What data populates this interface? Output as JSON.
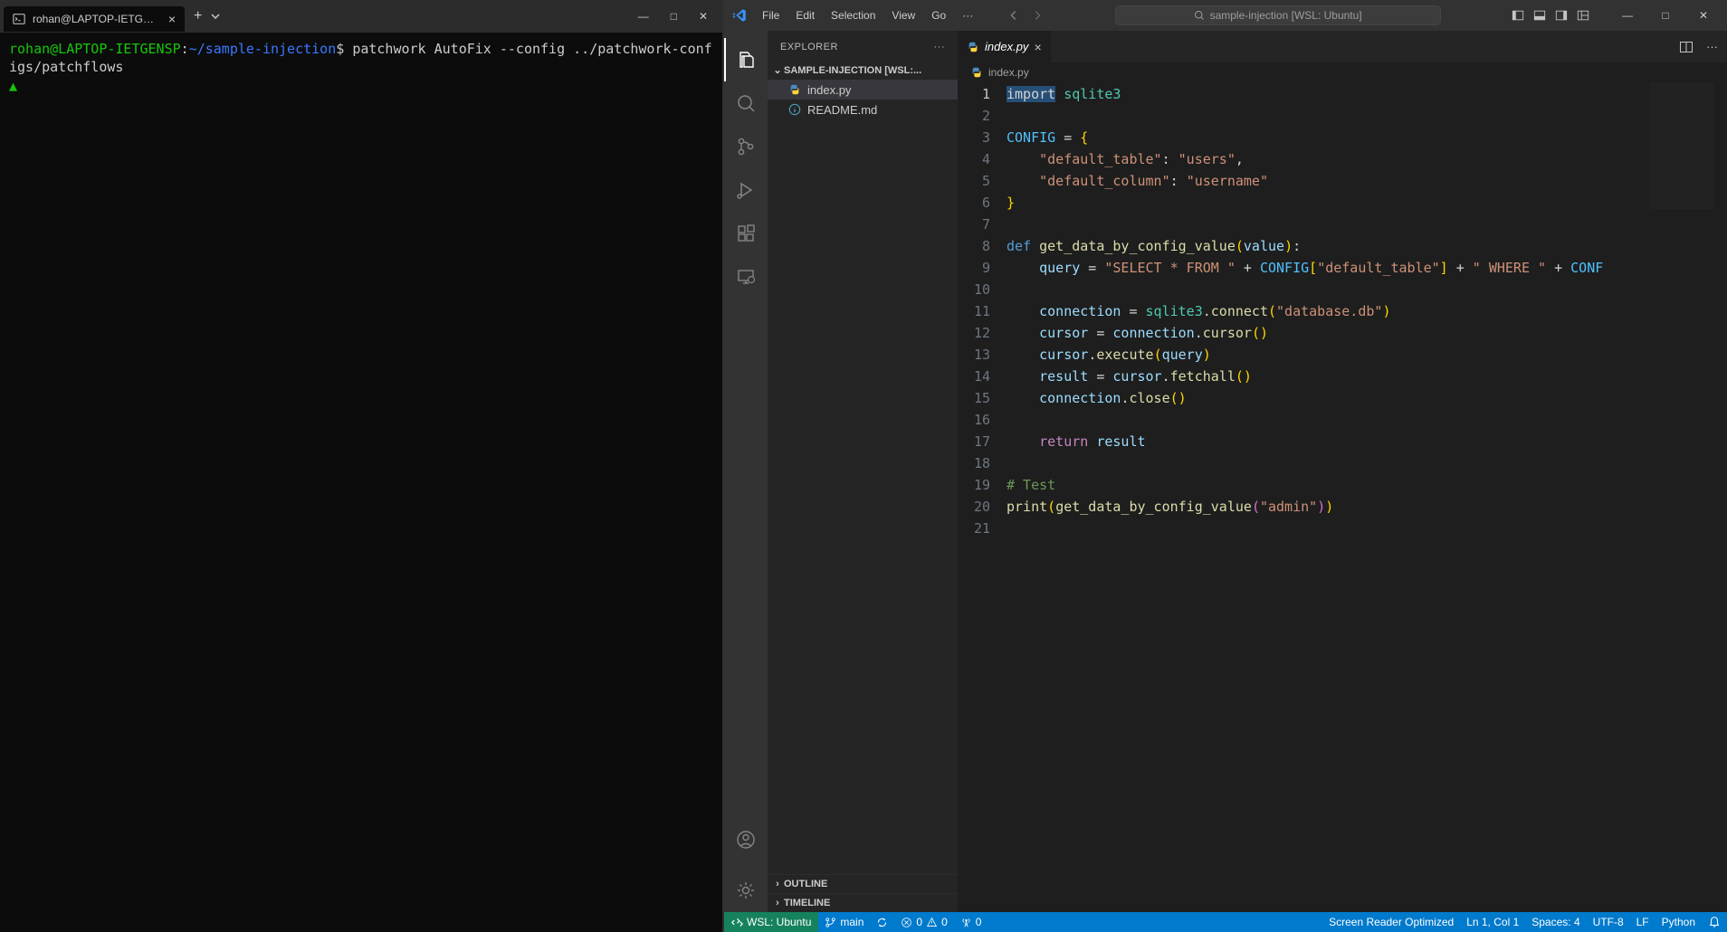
{
  "terminal": {
    "tab_title": "rohan@LAPTOP-IETGENSP: ~/...",
    "prompt_user": "rohan@LAPTOP-IETGENSP",
    "prompt_colon": ":",
    "prompt_path": "~/sample-injection",
    "prompt_symbol": "$",
    "command": "patchwork AutoFix --config ../patchwork-configs/patchflows",
    "cursor": "▲"
  },
  "vscode": {
    "menus": [
      "File",
      "Edit",
      "Selection",
      "View",
      "Go"
    ],
    "menu_more": "···",
    "command_center": "sample-injection [WSL: Ubuntu]",
    "sidebar_title": "EXPLORER",
    "project_title": "SAMPLE-INJECTION [WSL:...",
    "files": [
      {
        "name": "index.py",
        "icon": "python",
        "active": true
      },
      {
        "name": "README.md",
        "icon": "info",
        "active": false
      }
    ],
    "outline_label": "OUTLINE",
    "timeline_label": "TIMELINE",
    "open_tab": {
      "name": "index.py",
      "italic": true
    },
    "breadcrumb": "index.py",
    "code_lines": 21,
    "code": {
      "l1_import": "import",
      "l1_mod": " sqlite3",
      "l3_config": "CONFIG",
      "l3_eq": " = ",
      "l3_brace": "{",
      "l4_indent": "    ",
      "l4_key": "\"default_table\"",
      "l4_colon": ": ",
      "l4_val": "\"users\"",
      "l4_comma": ",",
      "l5_indent": "    ",
      "l5_key": "\"default_column\"",
      "l5_colon": ": ",
      "l5_val": "\"username\"",
      "l6_brace": "}",
      "l8_def": "def",
      "l8_fn": " get_data_by_config_value",
      "l8_p1": "(",
      "l8_param": "value",
      "l8_p2": ")",
      "l8_colon": ":",
      "l9_indent": "    ",
      "l9_var": "query",
      "l9_eq": " = ",
      "l9_s1": "\"SELECT * FROM \"",
      "l9_plus1": " + ",
      "l9_cfg": "CONFIG",
      "l9_b1": "[",
      "l9_key": "\"default_table\"",
      "l9_b2": "]",
      "l9_plus2": " + ",
      "l9_s2": "\" WHERE \"",
      "l9_plus3": " + ",
      "l9_cfg2": "CONF",
      "l11_indent": "    ",
      "l11_var": "connection",
      "l11_eq": " = ",
      "l11_mod": "sqlite3",
      "l11_dot": ".",
      "l11_fn": "connect",
      "l11_p1": "(",
      "l11_arg": "\"database.db\"",
      "l11_p2": ")",
      "l12_indent": "    ",
      "l12_var": "cursor",
      "l12_eq": " = ",
      "l12_conn": "connection",
      "l12_dot": ".",
      "l12_fn": "cursor",
      "l12_p": "()",
      "l13_indent": "    ",
      "l13_var": "cursor",
      "l13_dot": ".",
      "l13_fn": "execute",
      "l13_p1": "(",
      "l13_arg": "query",
      "l13_p2": ")",
      "l14_indent": "    ",
      "l14_var": "result",
      "l14_eq": " = ",
      "l14_cur": "cursor",
      "l14_dot": ".",
      "l14_fn": "fetchall",
      "l14_p": "()",
      "l15_indent": "    ",
      "l15_var": "connection",
      "l15_dot": ".",
      "l15_fn": "close",
      "l15_p": "()",
      "l17_indent": "    ",
      "l17_ret": "return",
      "l17_sp": " ",
      "l17_var": "result",
      "l19_com": "# Test",
      "l20_fn": "print",
      "l20_p1": "(",
      "l20_fn2": "get_data_by_config_value",
      "l20_p2": "(",
      "l20_arg": "\"admin\"",
      "l20_p3": ")",
      "l20_p4": ")"
    },
    "status": {
      "remote": "WSL: Ubuntu",
      "branch": "main",
      "sync": "",
      "errors": "0",
      "warnings": "0",
      "ports": "0",
      "screen_reader": "Screen Reader Optimized",
      "line_col": "Ln 1, Col 1",
      "spaces": "Spaces: 4",
      "encoding": "UTF-8",
      "eol": "LF",
      "lang": "Python"
    }
  }
}
